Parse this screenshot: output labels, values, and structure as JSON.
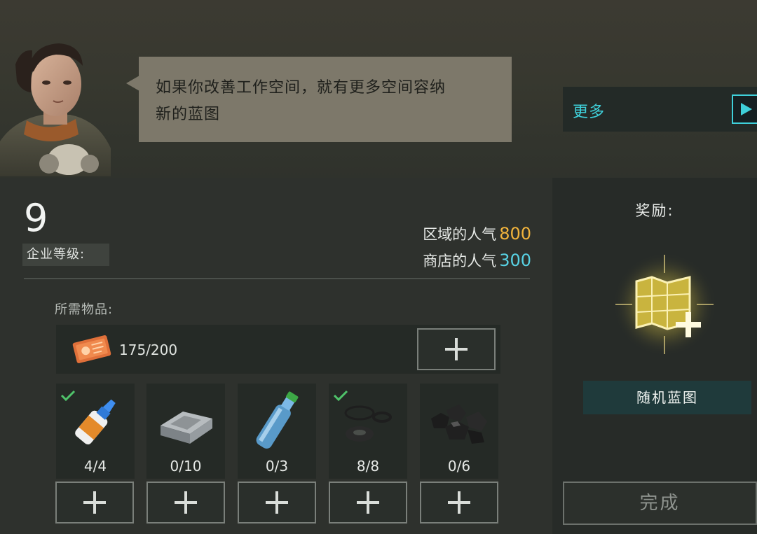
{
  "dialog": {
    "line1": "如果你改善工作空间，就有更多空间容纳",
    "line2": "新的蓝图"
  },
  "more": {
    "label": "更多"
  },
  "level": {
    "value": "9",
    "label": "企业等级:"
  },
  "stats": {
    "region_label": "区域的人气",
    "region_value": "800",
    "shop_label": "商店的人气",
    "shop_value": "300"
  },
  "required": {
    "label": "所需物品:",
    "currency_value": "175/200",
    "items": [
      {
        "icon": "glue-icon",
        "count": "4/4",
        "complete": true
      },
      {
        "icon": "metal-ingot-icon",
        "count": "0/10",
        "complete": false
      },
      {
        "icon": "water-bottle-icon",
        "count": "0/3",
        "complete": false
      },
      {
        "icon": "rubber-rings-icon",
        "count": "8/8",
        "complete": true
      },
      {
        "icon": "coal-icon",
        "count": "0/6",
        "complete": false
      }
    ]
  },
  "reward": {
    "title": "奖励:",
    "name": "随机蓝图"
  },
  "done_button": "完成",
  "colors": {
    "accent_cyan": "#3fd0da",
    "popularity_orange": "#f2b43c",
    "popularity_cyan": "#58d2e4",
    "check_green": "#4fc36a"
  }
}
